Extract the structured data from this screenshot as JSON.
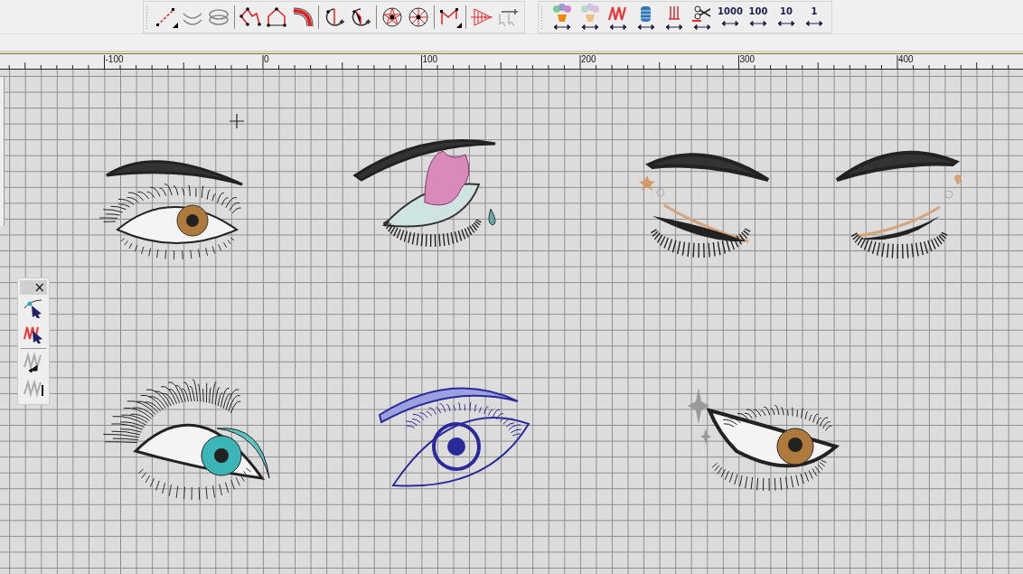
{
  "main_toolbar": {
    "groups": [
      [
        {
          "kind": "line"
        },
        {
          "kind": "curve"
        },
        {
          "kind": "rotate"
        }
      ],
      [
        {
          "kind": "polyline"
        },
        {
          "kind": "pentagon"
        },
        {
          "kind": "arc"
        }
      ],
      [
        {
          "kind": "split-circle"
        },
        {
          "kind": "split-circle-2"
        }
      ],
      [
        {
          "kind": "star-circle"
        },
        {
          "kind": "wheel"
        }
      ],
      [
        {
          "kind": "zigzag"
        }
      ],
      [
        {
          "kind": "fan"
        },
        {
          "kind": "select-add"
        }
      ]
    ]
  },
  "stitch_toolbar": {
    "tools": [
      {
        "kind": "flowers"
      },
      {
        "kind": "flowers-faded"
      },
      {
        "kind": "zigzag"
      },
      {
        "kind": "spool"
      },
      {
        "kind": "fork"
      },
      {
        "kind": "scissors"
      }
    ],
    "steps": [
      {
        "label": "1000"
      },
      {
        "label": "100"
      },
      {
        "label": "10"
      },
      {
        "label": "1"
      }
    ]
  },
  "ruler": {
    "labels": [
      {
        "label": "-100"
      },
      {
        "label": "0"
      },
      {
        "label": "100"
      },
      {
        "label": "200"
      },
      {
        "label": "300"
      },
      {
        "label": "400"
      }
    ]
  },
  "palette": {
    "close": "×",
    "tools": [
      {
        "kind": "node-select"
      },
      {
        "kind": "stitch-select"
      },
      {
        "kind": "stitch-return"
      },
      {
        "kind": "stitch-end"
      }
    ]
  }
}
